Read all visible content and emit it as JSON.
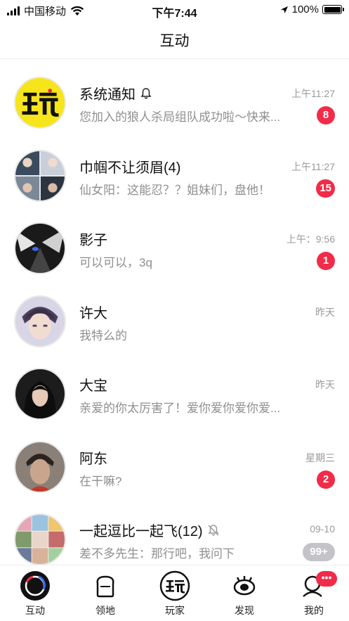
{
  "status_bar": {
    "carrier": "中国移动",
    "time": "下午7:44",
    "battery": "100%"
  },
  "header": {
    "title": "互动"
  },
  "conversations": [
    {
      "name": "系统通知",
      "muted_icon": "bell-icon",
      "preview": "您加入的狼人杀局组队成功啦～快来...",
      "time": "上午11:27",
      "badge": "8"
    },
    {
      "name": "巾帼不让须眉(4)",
      "preview": "仙女阳：这能忍？？姐妹们，盘他！",
      "time": "上午11:27",
      "badge": "15"
    },
    {
      "name": "影子",
      "preview": "可以可以，3q",
      "time": "上午：9:56",
      "badge": "1"
    },
    {
      "name": "许大",
      "preview": "我特么的",
      "time": "昨天"
    },
    {
      "name": "大宝",
      "preview": "亲爱的你太厉害了！爱你爱你爱你爱...",
      "time": "昨天"
    },
    {
      "name": "阿东",
      "preview": "在干嘛?",
      "time": "星期三",
      "badge": "2"
    },
    {
      "name": "一起逗比一起飞(12)",
      "muted_icon": "bell-off-icon",
      "preview": "差不多先生：那行吧，我问下",
      "time": "09-10",
      "badge": "99+"
    }
  ],
  "tab_bar": {
    "tabs": [
      {
        "label": "互动",
        "icon": "chat-bubble-icon"
      },
      {
        "label": "领地",
        "icon": "toast-icon"
      },
      {
        "label": "玩家",
        "icon": "wan-logo-icon"
      },
      {
        "label": "发现",
        "icon": "eye-icon"
      },
      {
        "label": "我的",
        "icon": "profile-icon",
        "badge": "•••"
      }
    ]
  },
  "colors": {
    "badge_red": "#f22b48",
    "badge_grey": "#c3c3c8",
    "logo_yellow": "#f6e51a"
  }
}
